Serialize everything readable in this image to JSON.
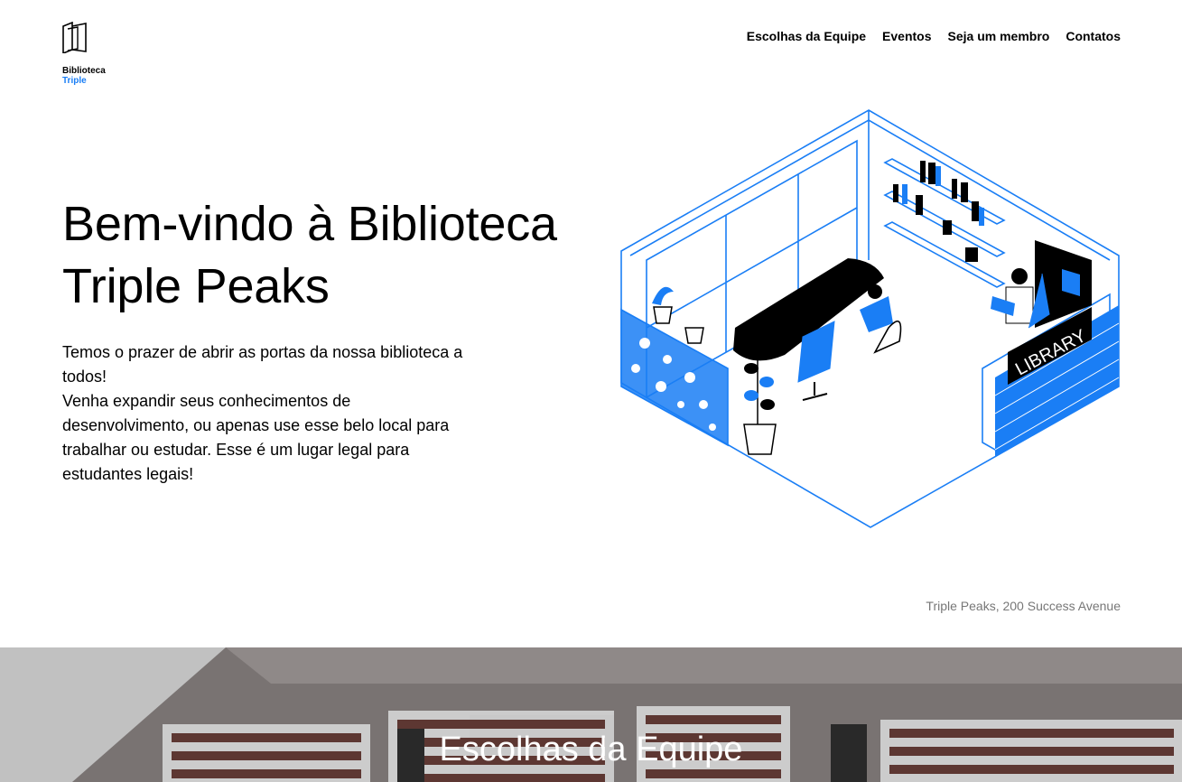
{
  "header": {
    "logo_line1": "Biblioteca",
    "logo_line2": "Triple",
    "nav": [
      {
        "label": "Escolhas da Equipe"
      },
      {
        "label": "Eventos"
      },
      {
        "label": "Seja um membro"
      },
      {
        "label": "Contatos"
      }
    ]
  },
  "hero": {
    "title": "Bem-vindo à Biblioteca Triple Peaks",
    "paragraph1": "Temos o prazer de abrir as portas da nossa biblioteca a todos!",
    "paragraph2": "Venha expandir seus conhecimentos de desenvolvimento, ou apenas use esse belo local para trabalhar ou estudar. Esse é um lugar legal para estudantes legais!",
    "illustration_sign": "LIBRARY",
    "address": "Triple Peaks, 200 Success Avenue"
  },
  "section": {
    "title": "Escolhas da Equipe"
  },
  "colors": {
    "accent": "#1a7ef5",
    "text": "#000000",
    "muted": "#777777"
  }
}
